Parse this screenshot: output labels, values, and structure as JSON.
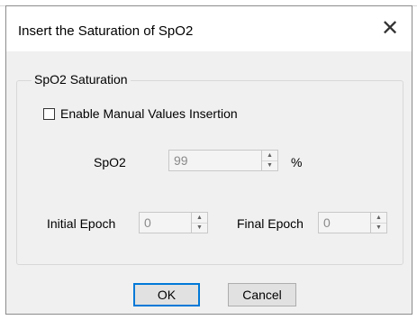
{
  "dialog": {
    "title": "Insert the Saturation of SpO2",
    "close_glyph": "✕"
  },
  "group": {
    "label": "SpO2 Saturation",
    "checkbox_label": "Enable Manual Values Insertion",
    "checkbox_checked": false
  },
  "spo2": {
    "label": "SpO2",
    "value": "99",
    "unit": "%"
  },
  "initial_epoch": {
    "label": "Initial Epoch",
    "value": "0"
  },
  "final_epoch": {
    "label": "Final Epoch",
    "value": "0"
  },
  "buttons": {
    "ok": "OK",
    "cancel": "Cancel"
  },
  "icons": {
    "spinner_up": "▲",
    "spinner_down": "▼"
  },
  "colors": {
    "accent": "#0078d7",
    "dialog_bg": "#f0f0f0",
    "disabled_text": "#8a8a8a"
  }
}
